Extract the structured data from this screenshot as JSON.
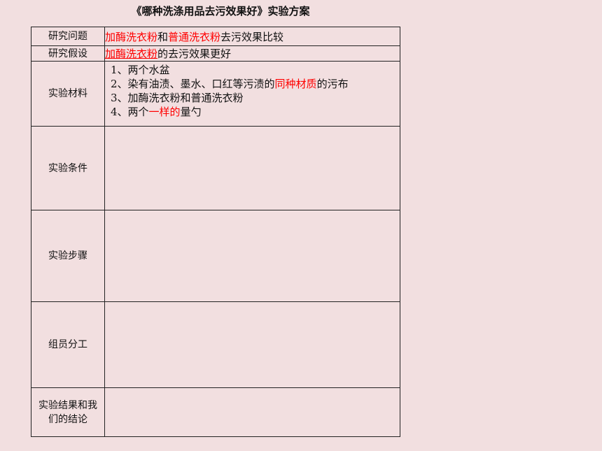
{
  "title": "《哪种洗涤用品去污效果好》实验方案",
  "rows": {
    "question": {
      "label": "研究问题",
      "parts": [
        "加酶洗衣粉",
        "和",
        "普通洗衣粉",
        "去污效果比较"
      ]
    },
    "hypothesis": {
      "label": "研究假设",
      "parts": [
        "加酶洗衣粉",
        "的去污效果更好"
      ]
    },
    "materials": {
      "label": "实验材料",
      "items": [
        {
          "pre": "1、两个水盆",
          "red": "",
          "post": ""
        },
        {
          "pre": "2、染有油渍、墨水、口红等污渍的",
          "red": "同种材质",
          "post": "的污布"
        },
        {
          "pre": "3、加酶洗衣粉和普通洗衣粉",
          "red": "",
          "post": ""
        },
        {
          "pre": "4、两个",
          "red": "一样的",
          "post": "量勺"
        }
      ]
    },
    "conditions": {
      "label": "实验条件"
    },
    "steps": {
      "label": "实验步骤"
    },
    "division": {
      "label": "组员分工"
    },
    "results": {
      "label": "实验结果和我们的结论"
    }
  },
  "colors": {
    "background": "#f2dfe0",
    "highlight": "#ff0000",
    "border": "#222222"
  }
}
